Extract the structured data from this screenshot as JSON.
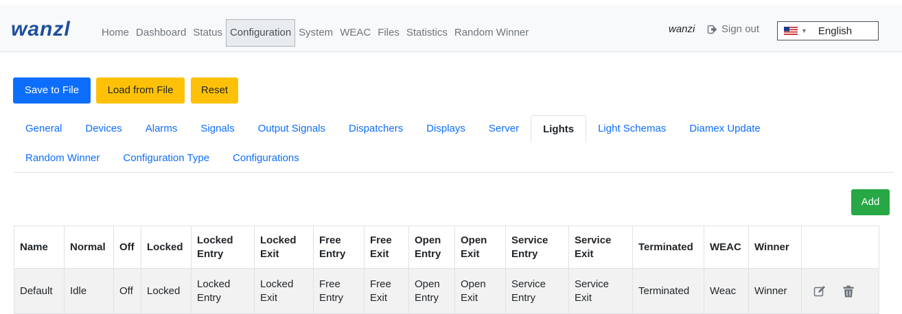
{
  "navbar": {
    "brand": "wanzl",
    "links": [
      "Home",
      "Dashboard",
      "Status",
      "Configuration",
      "System",
      "WEAC",
      "Files",
      "Statistics",
      "Random Winner"
    ],
    "active_link": "Configuration",
    "user": "wanzi",
    "sign_out": "Sign out",
    "language": "English",
    "icons": {
      "sign_out": "sign-out-icon",
      "flag": "us-flag-icon"
    }
  },
  "actions": {
    "save_to_file": "Save to File",
    "load_from_file": "Load from File",
    "reset": "Reset"
  },
  "tabs": {
    "row1": [
      "General",
      "Devices",
      "Alarms",
      "Signals",
      "Output Signals",
      "Dispatchers",
      "Displays",
      "Server",
      "Lights",
      "Light Schemas",
      "Diamex Update"
    ],
    "row2": [
      "Random Winner",
      "Configuration Type",
      "Configurations"
    ],
    "active": "Lights"
  },
  "add_button": "Add",
  "table": {
    "headers": [
      "Name",
      "Normal",
      "Off",
      "Locked",
      "Locked Entry",
      "Locked Exit",
      "Free Entry",
      "Free Exit",
      "Open Entry",
      "Open Exit",
      "Service Entry",
      "Service Exit",
      "Terminated",
      "WEAC",
      "Winner",
      ""
    ],
    "rows": [
      [
        "Default",
        "Idle",
        "Off",
        "Locked",
        "Locked Entry",
        "Locked Exit",
        "Free Entry",
        "Free Exit",
        "Open Entry",
        "Open Exit",
        "Service Entry",
        "Service Exit",
        "Terminated",
        "Weac",
        "Winner"
      ]
    ],
    "row_action_icons": [
      "edit-icon",
      "trash-icon"
    ]
  },
  "colors": {
    "primary": "#0d6efd",
    "warning": "#ffc107",
    "success": "#28a745",
    "brand": "#1e4f9c"
  }
}
